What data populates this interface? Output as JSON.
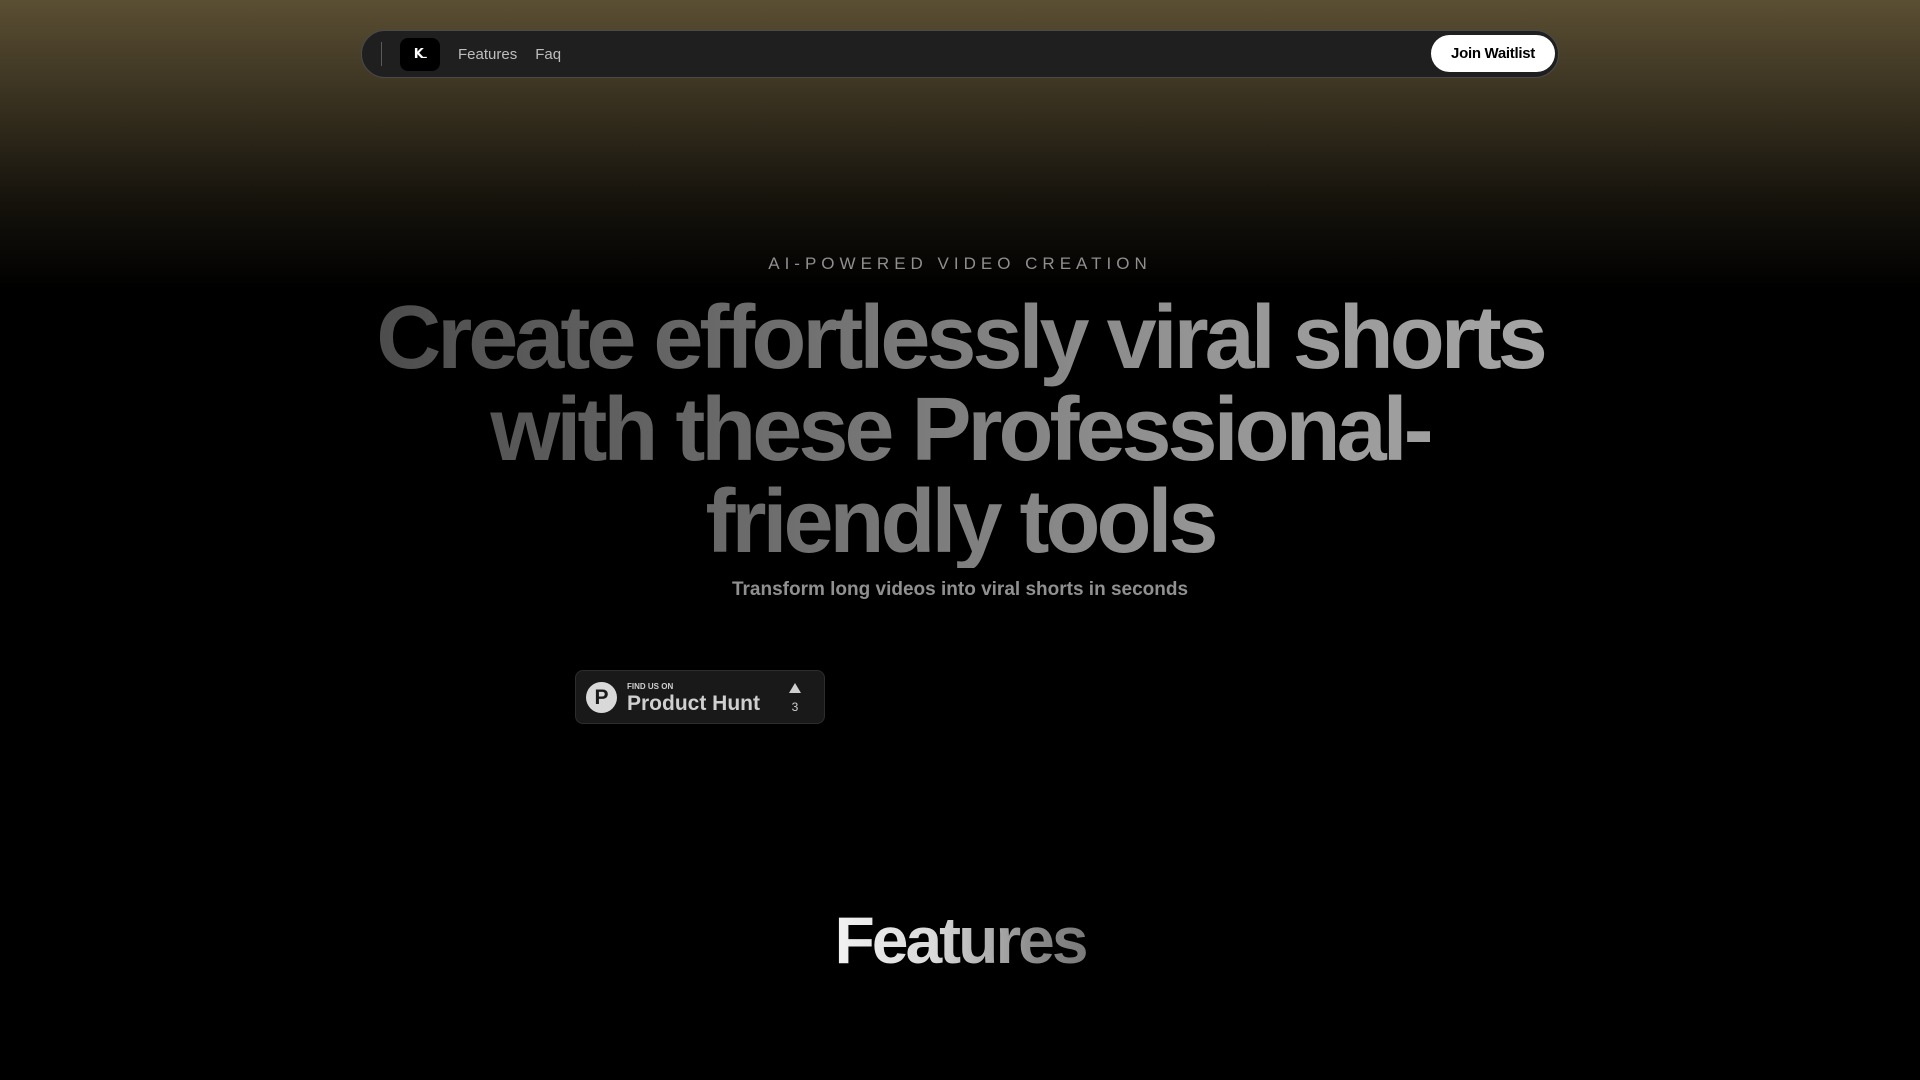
{
  "nav": {
    "logo_text": "K",
    "links": [
      {
        "label": "Features"
      },
      {
        "label": "Faq"
      }
    ],
    "cta_label": "Join Waitlist"
  },
  "hero": {
    "eyebrow": "AI-POWERED VIDEO CREATION",
    "headline": "Create effortlessly viral shorts with these Professional-friendly tools",
    "subheadline": "Transform long videos into viral shorts in seconds"
  },
  "product_hunt_badge": {
    "icon_letter": "P",
    "small_text": "FIND US ON",
    "big_text": "Product Hunt",
    "upvote_icon": "triangle-up-icon",
    "upvote_count": "3"
  },
  "features": {
    "title": "Features"
  },
  "colors": {
    "background": "#000000",
    "gradient_top": "#5b4f33",
    "nav_bg": "#1f1f1f",
    "cta_bg": "#ffffff"
  }
}
